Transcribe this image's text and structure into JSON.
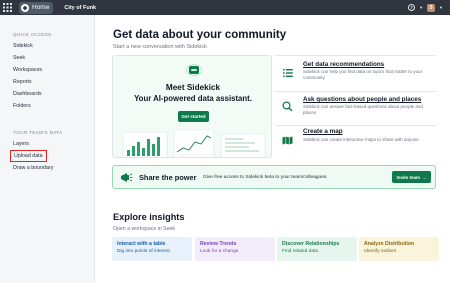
{
  "topbar": {
    "home_label": "Home",
    "app_title": "City of Funk",
    "help_glyph": "?",
    "avatar_initial": "S",
    "background": "#2f3640"
  },
  "sidebar": {
    "quick_access_heading": "QUICK ACCESS",
    "quick_items": [
      "Sidekick",
      "Seek",
      "Workspaces",
      "Reports",
      "Dashboards",
      "Folders"
    ],
    "team_heading": "YOUR TEAM'S DATA",
    "team_items": [
      "Layers",
      "Upload data",
      "Draw a boundary"
    ],
    "highlighted_item": "Upload data",
    "highlight_color": "#e02424"
  },
  "main": {
    "title": "Get data about your community",
    "subtitle": "Start a new conversation with Sidekick",
    "meet_card": {
      "title": "Meet Sidekick",
      "tagline": "Your AI-powered data assistant.",
      "button_label": "Get started"
    },
    "features": [
      {
        "icon": "list-icon",
        "title": "Get data recommendations",
        "desc": "Sidekick can help you find data on topics that matter to your community"
      },
      {
        "icon": "search-icon",
        "title": "Ask questions about people and places",
        "desc": "Sidekick can answer fact-based questions about people and places"
      },
      {
        "icon": "map-icon",
        "title": "Create a map",
        "desc": "Sidekick can create interactive maps to share with anyone"
      }
    ],
    "share": {
      "title": "Share the power",
      "desc": "Give free access to Sidekick beta to your team/colleagues.",
      "button_label": "Invite team",
      "button_arrow": "→"
    },
    "explore": {
      "title": "Explore insights",
      "subtitle": "Open a workspace in Seek",
      "tiles": [
        {
          "title": "Interact with a table",
          "subtitle": "Dig into points of interest",
          "bg": "#e6f1fb",
          "color": "#1c5fa8"
        },
        {
          "title": "Review Trends",
          "subtitle": "Look for a change",
          "bg": "#f3ecfb",
          "color": "#7a3fb8"
        },
        {
          "title": "Discover Relationships",
          "subtitle": "Find related data",
          "bg": "#e6f6ee",
          "color": "#1d7a4c"
        },
        {
          "title": "Analyze Distribution",
          "subtitle": "Identify outliers",
          "bg": "#fbf4dc",
          "color": "#8a6410"
        }
      ]
    }
  },
  "colors": {
    "brand_green": "#0e7a4b",
    "share_border": "#9ad6b7"
  }
}
